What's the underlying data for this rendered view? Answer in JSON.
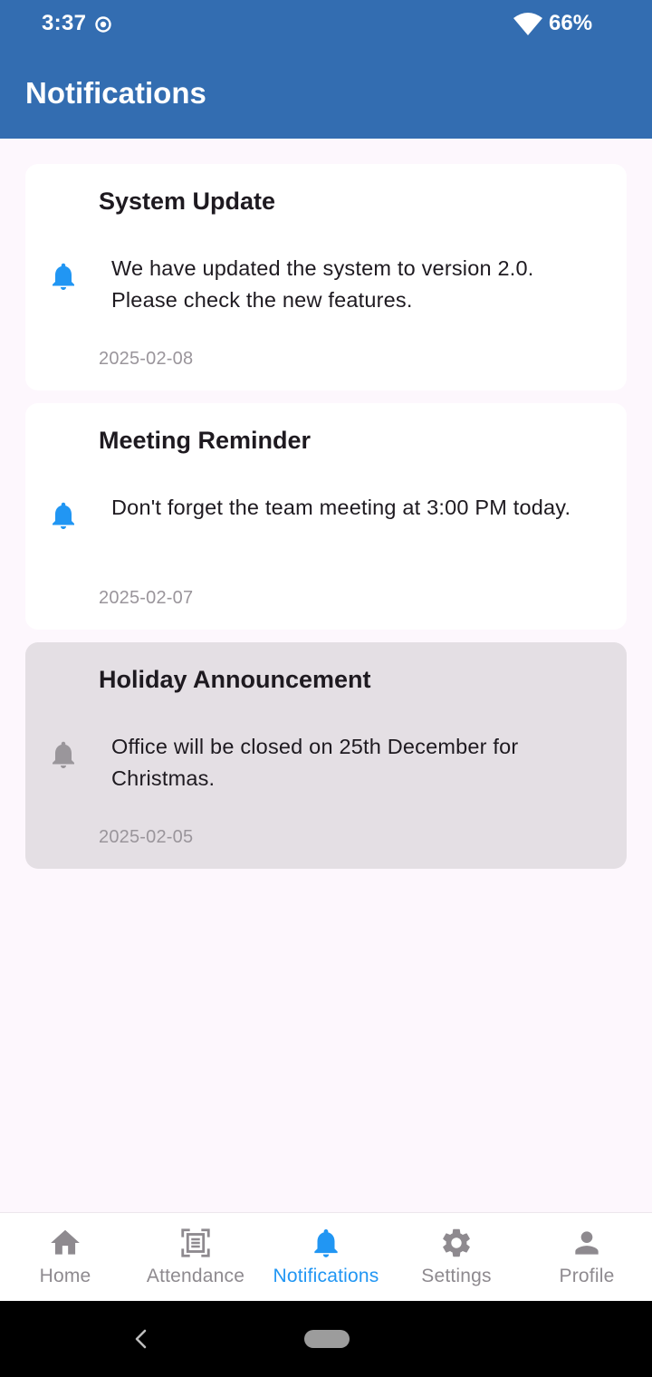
{
  "status_bar": {
    "time": "3:37",
    "battery": "66%",
    "icons": [
      "location-dot-icon",
      "wifi-icon"
    ]
  },
  "header": {
    "title": "Notifications"
  },
  "notifications": [
    {
      "title": "System Update",
      "message": "We have updated the system to version 2.0. Please check the new features.",
      "date": "2025-02-08",
      "read": false
    },
    {
      "title": "Meeting Reminder",
      "message": "Don't forget the team meeting at 3:00 PM today.",
      "date": "2025-02-07",
      "read": false
    },
    {
      "title": "Holiday Announcement",
      "message": "Office will be closed on 25th December for Christmas.",
      "date": "2025-02-05",
      "read": true
    }
  ],
  "bottom_nav": {
    "items": [
      {
        "label": "Home",
        "icon": "home-icon",
        "active": false
      },
      {
        "label": "Attendance",
        "icon": "attendance-scan-icon",
        "active": false
      },
      {
        "label": "Notifications",
        "icon": "bell-icon",
        "active": true
      },
      {
        "label": "Settings",
        "icon": "gear-icon",
        "active": false
      },
      {
        "label": "Profile",
        "icon": "person-icon",
        "active": false
      }
    ]
  },
  "colors": {
    "header_bg": "#336db1",
    "accent": "#2196f3",
    "inactive": "#8e8a8f",
    "read_card_bg": "#e4dfe4",
    "page_bg": "#fdf7fd"
  }
}
